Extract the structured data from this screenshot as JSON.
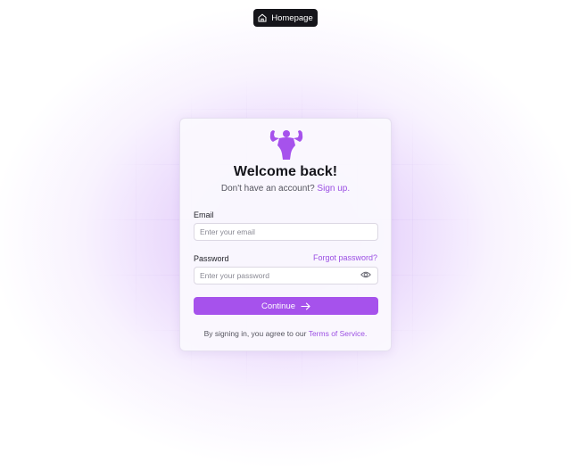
{
  "header": {
    "home_label": "Homepage"
  },
  "login": {
    "title": "Welcome back!",
    "subtitle_prefix": "Don't have an account?",
    "signup_link": "Sign up.",
    "email_label": "Email",
    "email_placeholder": "Enter your email",
    "password_label": "Password",
    "forgot_link": "Forgot password?",
    "password_placeholder": "Enter your password",
    "continue_label": "Continue",
    "terms_prefix": "By signing in, you agree to our",
    "terms_link": "Terms of Service."
  },
  "icons": {
    "home": "home-icon",
    "logo": "strongman-icon",
    "eye": "eye-icon",
    "arrow": "arrow-right-icon"
  },
  "colors": {
    "accent": "#a652ec",
    "link": "#9b4fe3",
    "dark_button": "#15151a"
  }
}
